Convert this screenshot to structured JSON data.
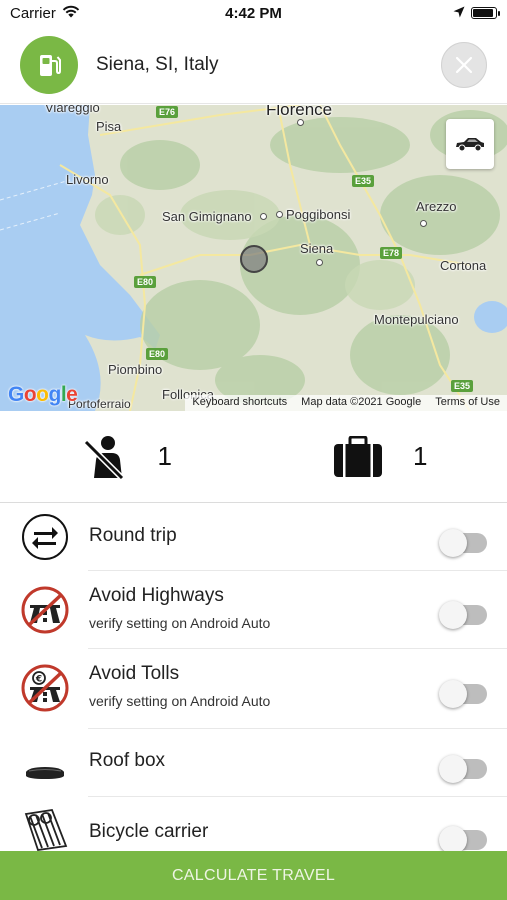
{
  "status_bar": {
    "carrier": "Carrier",
    "time": "4:42 PM",
    "battery_level": 0.9
  },
  "header": {
    "location": "Siena, SI, Italy",
    "fuel_icon": "fuel-pump-icon",
    "close_icon": "close-icon"
  },
  "map": {
    "cities": {
      "viareggio": "Viareggio",
      "pisa": "Pisa",
      "florence": "Florence",
      "livorno": "Livorno",
      "san_gimignano": "San Gimignano",
      "poggibonsi": "Poggibonsi",
      "arezzo": "Arezzo",
      "siena": "Siena",
      "cortona": "Cortona",
      "montepulciano": "Montepulciano",
      "piombino": "Piombino",
      "follonica": "Follonica",
      "portoferraio": "Portoferraio"
    },
    "roads": {
      "e76": "E76",
      "e35_top": "E35",
      "e35_bottom": "E35",
      "e78": "E78",
      "e80_top": "E80",
      "e80_bottom": "E80"
    },
    "google": "Google",
    "footer": {
      "shortcuts": "Keyboard shortcuts",
      "map_data": "Map data ©2021 Google",
      "terms": "Terms of Use"
    }
  },
  "counters": {
    "passengers": "1",
    "luggage": "1"
  },
  "options": [
    {
      "title": "Round trip",
      "subtitle": "",
      "checked": false
    },
    {
      "title": "Avoid Highways",
      "subtitle": "verify setting on Android Auto",
      "checked": false
    },
    {
      "title": "Avoid Tolls",
      "subtitle": "verify setting on Android Auto",
      "checked": false
    },
    {
      "title": "Roof box",
      "subtitle": "",
      "checked": false
    },
    {
      "title": "Bicycle carrier",
      "subtitle": "",
      "checked": false
    }
  ],
  "calculate_button": "CALCULATE TRAVEL",
  "colors": {
    "accent": "#7ab845",
    "sea": "#9fc9f0",
    "prohibit_red": "#c0392b"
  }
}
